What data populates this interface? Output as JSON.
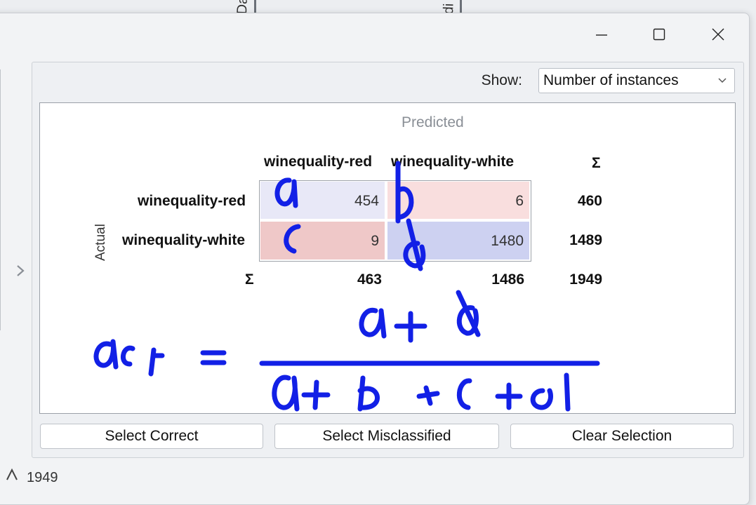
{
  "background": {
    "text_1": "Da",
    "text_2": "di"
  },
  "window": {
    "controls": {
      "minimize_icon": "minimize-icon",
      "maximize_icon": "maximize-icon",
      "close_icon": "close-icon"
    }
  },
  "show": {
    "label": "Show:",
    "selected": "Number of instances"
  },
  "matrix": {
    "predicted_label": "Predicted",
    "actual_label": "Actual",
    "col_headers": [
      "winequality-red",
      "winequality-white"
    ],
    "row_headers": [
      "winequality-red",
      "winequality-white"
    ],
    "sum_symbol": "Σ",
    "cells": [
      [
        "454",
        "6"
      ],
      [
        "9",
        "1480"
      ]
    ],
    "row_totals": [
      "460",
      "1489"
    ],
    "col_totals": [
      "463",
      "1486"
    ],
    "grand_total": "1949",
    "colors": {
      "correct_light": "#e8e8f7",
      "correct_dark": "#cdd1f1",
      "wrong_light": "#f9dede",
      "wrong_dark": "#efc8c8"
    }
  },
  "annotation": {
    "cell_letters": [
      "a",
      "b",
      "c",
      "d"
    ],
    "formula_lhs": "acc",
    "numerator": "a + d",
    "denominator": "a + b + c + d",
    "ink_color": "#1220e6"
  },
  "buttons": {
    "select_correct": "Select Correct",
    "select_misclassified": "Select Misclassified",
    "clear_selection": "Clear Selection"
  },
  "status": {
    "text": "1949"
  }
}
